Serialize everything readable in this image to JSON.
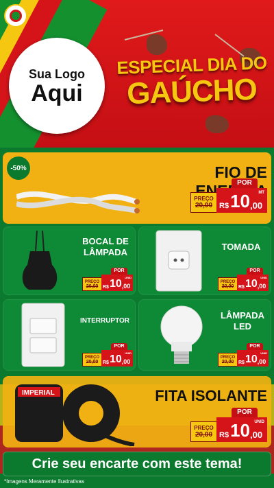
{
  "header": {
    "logo_line1": "Sua Logo",
    "logo_line2": "Aqui",
    "title_line1": "ESPECIAL DIA DO",
    "title_line2": "GAÚCHO"
  },
  "colors": {
    "red": "#d5141a",
    "green": "#0b7a2e",
    "yellow": "#f5c710"
  },
  "products": [
    {
      "name": "FIO DE ENERGIA",
      "badge": "-50%",
      "preco_label": "PREÇO",
      "old_price": "20,00",
      "por_label": "POR",
      "currency": "R$",
      "price": "10",
      "cents": ",00",
      "unit": "MT"
    },
    {
      "name": "BOCAL DE LÂMPADA",
      "preco_label": "PREÇO",
      "old_price": "20,00",
      "por_label": "POR",
      "currency": "R$",
      "price": "10",
      "cents": ",00",
      "unit": "UNID"
    },
    {
      "name": "TOMADA",
      "preco_label": "PREÇO",
      "old_price": "20,00",
      "por_label": "POR",
      "currency": "R$",
      "price": "10",
      "cents": ",00",
      "unit": "UNID"
    },
    {
      "name": "INTERRUPTOR",
      "preco_label": "PREÇO",
      "old_price": "20,00",
      "por_label": "POR",
      "currency": "R$",
      "price": "10",
      "cents": ",00",
      "unit": "UNID"
    },
    {
      "name": "LÂMPADA LED",
      "preco_label": "PREÇO",
      "old_price": "20,00",
      "por_label": "POR",
      "currency": "R$",
      "price": "10",
      "cents": ",00",
      "unit": "UNID"
    },
    {
      "name": "FITA ISOLANTE",
      "preco_label": "PREÇO",
      "old_price": "20,00",
      "por_label": "POR",
      "currency": "R$",
      "price": "10",
      "cents": ",00",
      "unit": "UNID",
      "tape_brand": "IMPERIAL"
    }
  ],
  "cta": "Crie seu encarte com este tema!",
  "disclaimer": "*Imagens Meramente Ilustrativas"
}
